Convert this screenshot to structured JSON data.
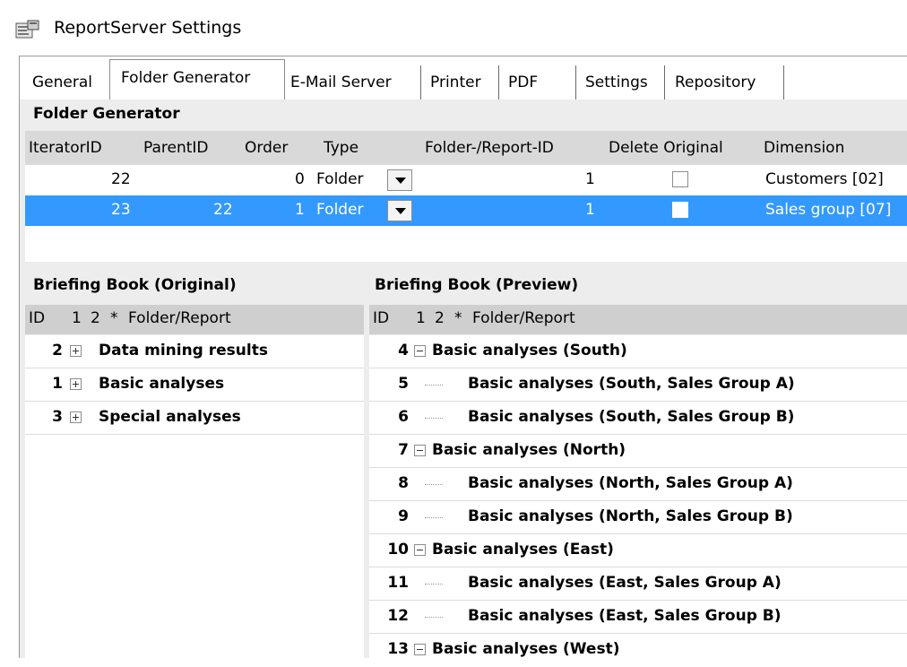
{
  "window": {
    "title": "ReportServer Settings",
    "icon": "settings-window-icon"
  },
  "tabs": [
    {
      "label": "General"
    },
    {
      "label": "Folder Generator"
    },
    {
      "label": "E-Mail Server"
    },
    {
      "label": "Printer"
    },
    {
      "label": "PDF"
    },
    {
      "label": "Settings"
    },
    {
      "label": "Repository"
    }
  ],
  "folder_generator": {
    "title": "Folder Generator",
    "columns": [
      "IteratorID",
      "ParentID",
      "Order",
      "Type",
      "Folder-/Report-ID",
      "Delete Original",
      "Dimension"
    ],
    "rows": [
      {
        "iterator_id": "22",
        "parent_id": "",
        "order": "0",
        "type": "Folder",
        "folder_report_id": "1",
        "delete_original": false,
        "dimension": "Customers [02]",
        "selected": false
      },
      {
        "iterator_id": "23",
        "parent_id": "22",
        "order": "1",
        "type": "Folder",
        "folder_report_id": "1",
        "delete_original": false,
        "dimension": "Sales group [07]",
        "selected": true
      }
    ]
  },
  "briefing_original": {
    "title": "Briefing Book (Original)",
    "columns": {
      "id": "ID",
      "c1": "1",
      "c2": "2",
      "star": "*",
      "folder": "Folder/Report"
    },
    "items": [
      {
        "id": "2",
        "label": "Data mining results"
      },
      {
        "id": "1",
        "label": "Basic analyses"
      },
      {
        "id": "3",
        "label": "Special analyses"
      }
    ]
  },
  "briefing_preview": {
    "title": "Briefing Book (Preview)",
    "columns": {
      "id": "ID",
      "c1": "1",
      "c2": "2",
      "star": "*",
      "folder": "Folder/Report"
    },
    "items": [
      {
        "id": "4",
        "label": "Basic analyses (South)",
        "level": 0
      },
      {
        "id": "5",
        "label": "Basic analyses (South, Sales Group A)",
        "level": 1
      },
      {
        "id": "6",
        "label": "Basic analyses (South, Sales Group B)",
        "level": 1
      },
      {
        "id": "7",
        "label": "Basic analyses (North)",
        "level": 0
      },
      {
        "id": "8",
        "label": "Basic analyses (North, Sales Group A)",
        "level": 1
      },
      {
        "id": "9",
        "label": "Basic analyses (North, Sales Group B)",
        "level": 1
      },
      {
        "id": "10",
        "label": "Basic analyses (East)",
        "level": 0
      },
      {
        "id": "11",
        "label": "Basic analyses (East, Sales Group A)",
        "level": 1
      },
      {
        "id": "12",
        "label": "Basic analyses (East, Sales Group B)",
        "level": 1
      },
      {
        "id": "13",
        "label": "Basic analyses (West)",
        "level": 0
      }
    ]
  },
  "colors": {
    "selection": "#3399ff",
    "panel": "#ededed",
    "header": "#d9d9d9"
  }
}
